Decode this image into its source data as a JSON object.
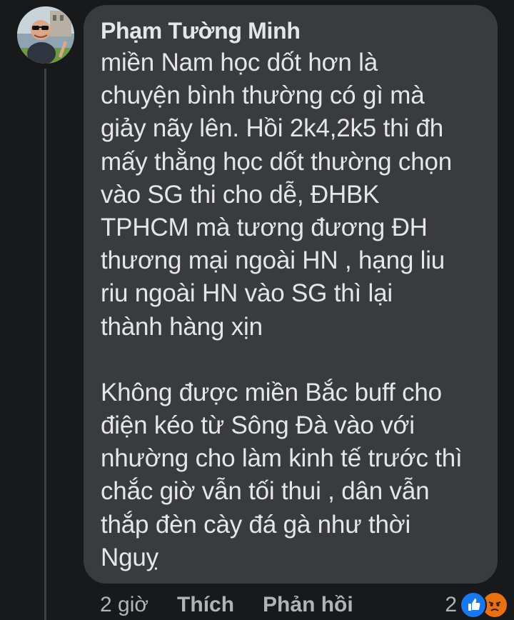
{
  "comment": {
    "author": "Phạm Tường Minh",
    "lines": [
      "miền Nam học dốt hơn là",
      "chuyện bình thường có gì mà",
      "giảy nãy lên. Hồi 2k4,2k5 thi đh",
      "mấy thằng học dốt thường chọn",
      "vào SG thi cho dễ, ĐHBK",
      "TPHCM mà tương đương ĐH",
      "thương mại ngoài HN , hạng liu",
      "riu  ngoài HN vào SG thì lại",
      "thành hàng xịn",
      "",
      "Không được miền Bắc buff cho",
      "điện kéo từ Sông Đà vào với",
      "nhường cho làm kinh tế trước thì",
      "chắc giờ vẫn tối thui , dân vẫn",
      "thắp đèn cày đá gà như thời",
      "Nguỵ"
    ]
  },
  "actions": {
    "time": "2 giờ",
    "like_label": "Thích",
    "reply_label": "Phản hồi"
  },
  "reactions": {
    "count": "2",
    "icons": [
      "like-icon",
      "angry-icon"
    ],
    "colors": {
      "like": "#1877f2",
      "angry": "#e9710f"
    }
  }
}
